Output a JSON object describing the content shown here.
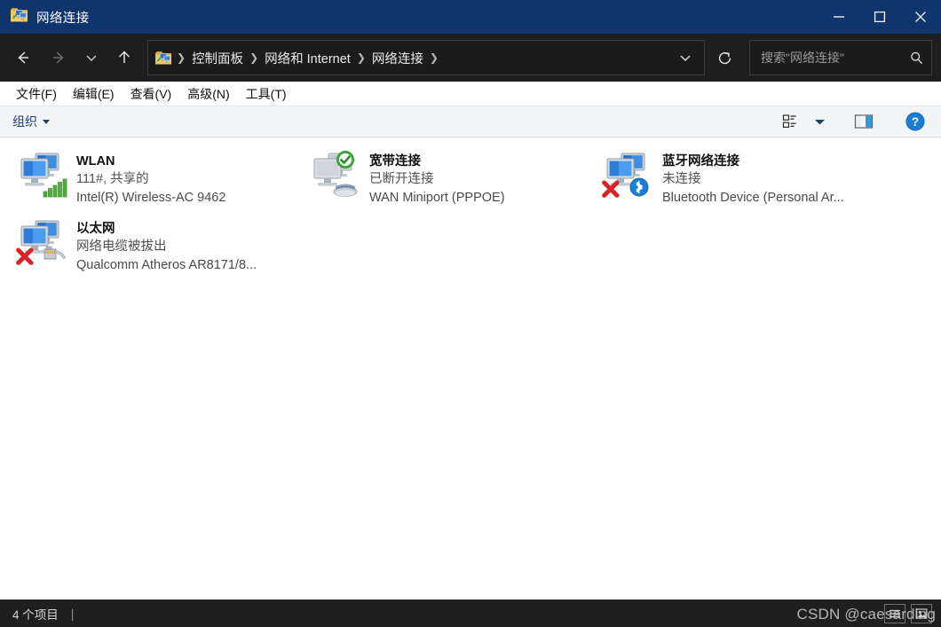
{
  "window": {
    "title": "网络连接",
    "title_icon": "network-connections-folder-icon",
    "controls": {
      "minimize": "minimize-icon",
      "maximize": "maximize-icon",
      "close": "close-icon"
    },
    "colors": {
      "titlebar": "#10346e",
      "navbar": "#1e1e1e",
      "toolbar": "#f3f4f6",
      "statusbar": "#1f1f1f",
      "link": "#1d3f73",
      "accent_blue": "#1a7fd4"
    }
  },
  "navbar": {
    "back": "back-arrow-icon",
    "forward": "forward-arrow-icon",
    "recent": "chevron-down-icon",
    "up": "up-arrow-icon",
    "breadcrumbs": [
      {
        "label": "控制面板"
      },
      {
        "label": "网络和 Internet"
      },
      {
        "label": "网络连接"
      }
    ],
    "breadcrumb_separator": "❯",
    "address_dropdown": "chevron-down-icon",
    "refresh": "refresh-icon"
  },
  "search": {
    "placeholder": "搜索\"网络连接\"",
    "value": "",
    "icon": "search-icon"
  },
  "menubar": {
    "items": [
      {
        "label": "文件(F)"
      },
      {
        "label": "编辑(E)"
      },
      {
        "label": "查看(V)"
      },
      {
        "label": "高级(N)"
      },
      {
        "label": "工具(T)"
      }
    ]
  },
  "toolbar": {
    "organize_label": "组织",
    "organize_caret": "caret-down-icon",
    "view_options_icon": "view-options-icon",
    "view_options_caret": "chevron-down-icon",
    "preview_pane_icon": "preview-pane-icon",
    "help_icon": "help-question-icon"
  },
  "connections": [
    {
      "name": "WLAN",
      "status": "111#, 共享的",
      "device": "Intel(R) Wireless-AC 9462",
      "icon": "network-adapter-icon",
      "badge": "signal-bars-icon"
    },
    {
      "name": "宽带连接",
      "status": "已断开连接",
      "device": "WAN Miniport (PPPOE)",
      "icon": "network-adapter-disabled-icon",
      "badge": "green-check-icon",
      "badge2": "modem-icon"
    },
    {
      "name": "蓝牙网络连接",
      "status": "未连接",
      "device": "Bluetooth Device (Personal Ar...",
      "icon": "network-adapter-icon",
      "badge": "bluetooth-icon",
      "badge2": "red-x-icon"
    },
    {
      "name": "以太网",
      "status": "网络电缆被拔出",
      "device": "Qualcomm Atheros AR8171/8...",
      "icon": "network-adapter-icon",
      "badge": "rj45-plug-icon",
      "badge2": "red-x-icon"
    }
  ],
  "statusbar": {
    "item_count_label": "4 个项目",
    "divider": "|",
    "details_view_icon": "details-view-icon",
    "icons_view_icon": "large-icons-view-icon",
    "watermark": "CSDN @caesarding"
  }
}
